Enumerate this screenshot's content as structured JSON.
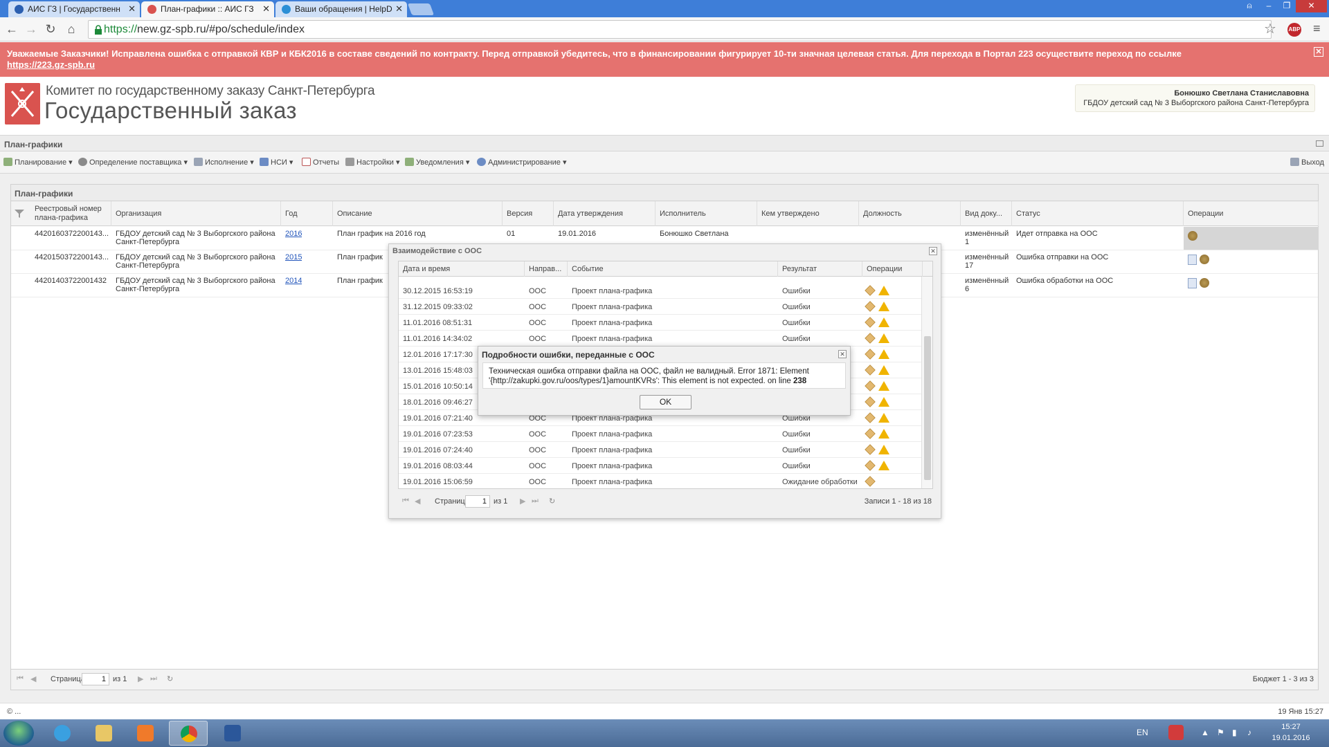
{
  "browser": {
    "tabs": [
      {
        "label": "АИС ГЗ | Государственн",
        "active": false
      },
      {
        "label": "План-графики :: АИС ГЗ",
        "active": true
      },
      {
        "label": "Ваши обращения | HelpD",
        "active": false
      }
    ],
    "url_scheme": "https://",
    "url_rest": "new.gz-spb.ru/#po/schedule/index",
    "abp_label": "ABP"
  },
  "banner": {
    "text": "Уважаемые Заказчики! Исправлена ошибка с отправкой КВР и КБК2016 в составе сведений по контракту. Перед отправкой убедитесь, что в финансировании фигурирует 10-ти значная целевая статья. Для перехода в Портал 223 осуществите переход по ссылке",
    "link": "https://223.gz-spb.ru",
    "color": "#e5726f"
  },
  "header": {
    "logo_small": "Комитет по государственному заказу Санкт-Петербурга",
    "logo_big": "Государственный заказ",
    "user_name": "Бонюшко Светлана Станиславовна",
    "user_org": "ГБДОУ детский сад № 3 Выборгского района Санкт-Петербурга"
  },
  "section_title": "План-графики",
  "menu": [
    {
      "label": "Планирование",
      "icon": "planning-icon"
    },
    {
      "label": "Определение поставщика",
      "icon": "supplier-icon"
    },
    {
      "label": "Исполнение",
      "icon": "execution-icon"
    },
    {
      "label": "НСИ",
      "icon": "reference-icon"
    },
    {
      "label": "Отчеты",
      "icon": "reports-icon"
    },
    {
      "label": "Настройки",
      "icon": "settings-icon"
    },
    {
      "label": "Уведомления",
      "icon": "notifications-icon"
    },
    {
      "label": "Администрирование",
      "icon": "admin-icon"
    }
  ],
  "exit_label": "Выход",
  "panel": {
    "title": "План-графики",
    "columns": [
      "Реестровый номер плана-графика",
      "Организация",
      "Год",
      "Описание",
      "Версия",
      "Дата утверждения",
      "Исполнитель",
      "Кем утверждено",
      "Должность",
      "Вид доку...",
      "Статус",
      "Операции"
    ],
    "rows": [
      {
        "reg": "4420160372200143...",
        "org": "ГБДОУ детский сад № 3 Выборгского района Санкт-Петербурга",
        "year": "2016",
        "desc": "План график на 2016 год",
        "version": "01",
        "date": "19.01.2016",
        "executor": "Бонюшко Светлана",
        "doc": "изменённый",
        "doc_num": "1",
        "status": "Идет отправка на ООС"
      },
      {
        "reg": "4420150372200143...",
        "org": "ГБДОУ детский сад № 3 Выборгского района Санкт-Петербурга",
        "year": "2015",
        "desc": "План график",
        "version": "",
        "date": "",
        "executor": "",
        "doc": "изменённый",
        "doc_num": "17",
        "status": "Ошибка отправки на ООС"
      },
      {
        "reg": "44201403722001432",
        "org": "ГБДОУ детский сад № 3 Выборгского района Санкт-Петербурга",
        "year": "2014",
        "desc": "План график",
        "version": "",
        "date": "",
        "executor": "",
        "doc": "изменённый",
        "doc_num": "6",
        "status": "Ошибка обработки на ООС"
      }
    ],
    "pager": {
      "page_label": "Страница",
      "page": "1",
      "of": "из 1",
      "summary": "Бюджет 1 - 3 из 3"
    }
  },
  "status_left": "© ...",
  "status_right": "19 Янв 15:27",
  "oos_dialog": {
    "title": "Взаимодействие с ООС",
    "columns": [
      "Дата и время",
      "Направ...",
      "Событие",
      "Результат",
      "Операции"
    ],
    "rows": [
      {
        "dt": "30.12.2015 16:53:19",
        "dir": "ООС",
        "event": "Проект плана-графика",
        "result": "Ошибки",
        "warn": true
      },
      {
        "dt": "31.12.2015 09:33:02",
        "dir": "ООС",
        "event": "Проект плана-графика",
        "result": "Ошибки",
        "warn": true
      },
      {
        "dt": "11.01.2016 08:51:31",
        "dir": "ООС",
        "event": "Проект плана-графика",
        "result": "Ошибки",
        "warn": true
      },
      {
        "dt": "11.01.2016 14:34:02",
        "dir": "ООС",
        "event": "Проект плана-графика",
        "result": "Ошибки",
        "warn": true
      },
      {
        "dt": "12.01.2016 17:17:30",
        "dir": "",
        "event": "",
        "result": "",
        "warn": true
      },
      {
        "dt": "13.01.2016 15:48:03",
        "dir": "",
        "event": "",
        "result": "",
        "warn": true
      },
      {
        "dt": "15.01.2016 10:50:14",
        "dir": "",
        "event": "",
        "result": "",
        "warn": true
      },
      {
        "dt": "18.01.2016 09:46:27",
        "dir": "",
        "event": "",
        "result": "",
        "warn": true
      },
      {
        "dt": "19.01.2016 07:21:40",
        "dir": "ООС",
        "event": "Проект плана-графика",
        "result": "Ошибки",
        "warn": true
      },
      {
        "dt": "19.01.2016 07:23:53",
        "dir": "ООС",
        "event": "Проект плана-графика",
        "result": "Ошибки",
        "warn": true
      },
      {
        "dt": "19.01.2016 07:24:40",
        "dir": "ООС",
        "event": "Проект плана-графика",
        "result": "Ошибки",
        "warn": true
      },
      {
        "dt": "19.01.2016 08:03:44",
        "dir": "ООС",
        "event": "Проект плана-графика",
        "result": "Ошибки",
        "warn": true
      },
      {
        "dt": "19.01.2016 15:06:59",
        "dir": "ООС",
        "event": "Проект плана-графика",
        "result": "Ожидание обработки",
        "warn": false
      }
    ],
    "pager": {
      "page_label": "Страница",
      "page": "1",
      "of": "из 1",
      "summary": "Записи 1 - 18 из 18"
    }
  },
  "error_modal": {
    "title": "Подробности ошибки, переданные с ООС",
    "message": "Техническая ошибка отправки файла на ООС, файл не валидный. Error 1871: Element '{http://zakupki.gov.ru/oos/types/1}amountKVRs': This element is not expected. on line",
    "line": "238",
    "ok": "OK"
  },
  "taskbar": {
    "lang": "EN",
    "time": "15:27",
    "date": "19.01.2016"
  }
}
